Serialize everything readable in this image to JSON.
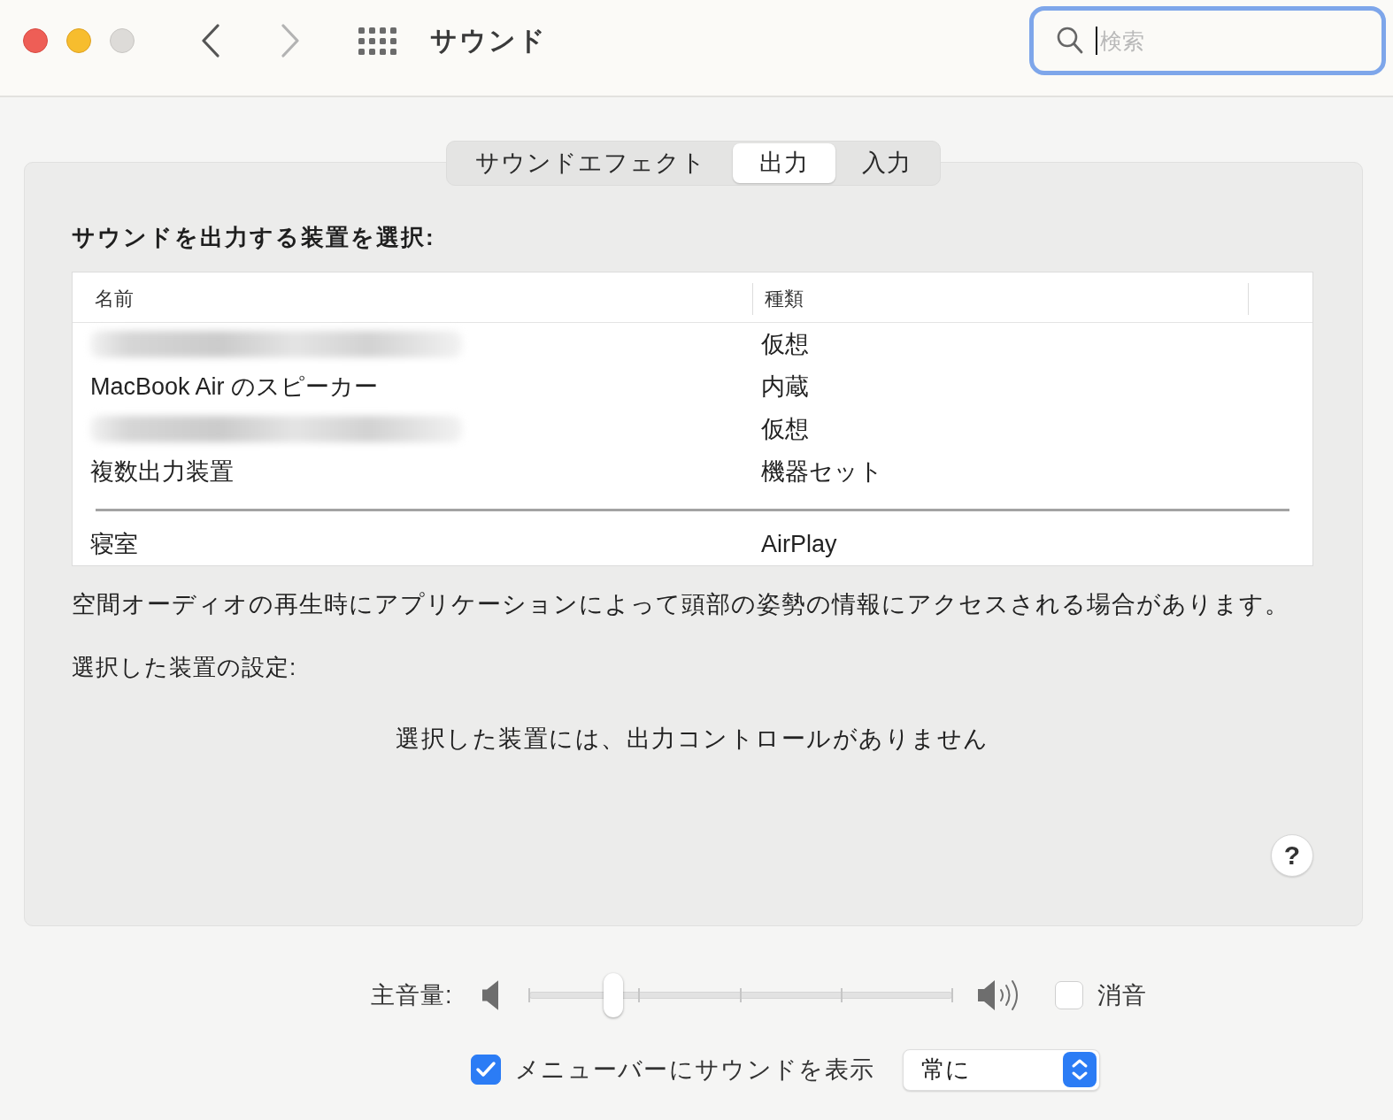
{
  "window": {
    "title": "サウンド",
    "back": {
      "disabled": false
    },
    "forward": {
      "disabled": true
    }
  },
  "search": {
    "placeholder": "検索",
    "focused": true
  },
  "tabs": [
    {
      "label": "サウンドエフェクト",
      "selected": false
    },
    {
      "label": "出力",
      "selected": true
    },
    {
      "label": "入力",
      "selected": false
    }
  ],
  "output": {
    "heading": "サウンドを出力する装置を選択:",
    "columns": [
      "名前",
      "種類"
    ],
    "rows": [
      {
        "kind": "device",
        "name_blurred": true,
        "type": "仮想",
        "selected": false
      },
      {
        "kind": "device",
        "name": "MacBook Air のスピーカー",
        "name_blurred": false,
        "type": "内蔵",
        "selected": false
      },
      {
        "kind": "device",
        "name_blurred": true,
        "type": "仮想",
        "selected": false
      },
      {
        "kind": "device",
        "name": "複数出力装置",
        "name_blurred": false,
        "type": "機器セット",
        "selected": false
      },
      {
        "kind": "separator"
      },
      {
        "kind": "device",
        "name": "寝室",
        "name_blurred": false,
        "type": "AirPlay",
        "selected": false
      }
    ],
    "note": "空間オーディオの再生時にアプリケーションによって頭部の姿勢の情報にアクセスされる場合があります。",
    "settings_heading": "選択した装置の設定:",
    "settings_message": "選択した装置には、出力コントロールがありません",
    "help": "?"
  },
  "volume": {
    "label": "主音量:",
    "level": 0.2
  },
  "mute": {
    "label": "消音",
    "checked": false
  },
  "menu_bar": {
    "label": "メニューバーにサウンドを表示",
    "checked": true
  },
  "menu_bar_popup": {
    "value": "常に"
  }
}
